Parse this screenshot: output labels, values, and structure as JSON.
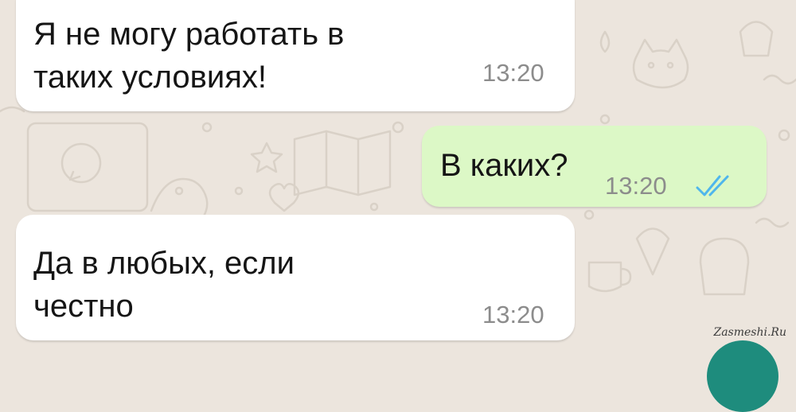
{
  "chat": {
    "messages": [
      {
        "direction": "incoming",
        "text": "Я не могу работать в\nтаких условиях!",
        "time": "13:20"
      },
      {
        "direction": "outgoing",
        "text": "В каких?",
        "time": "13:20",
        "status": "read"
      },
      {
        "direction": "incoming",
        "text": "Да в любых, если\nчестно",
        "time": "13:20"
      }
    ]
  },
  "watermark": "Zasmeshi.Ru",
  "colors": {
    "background": "#ece5dd",
    "incoming_bubble": "#ffffff",
    "outgoing_bubble": "#dcf8c6",
    "read_ticks": "#4fb6ec",
    "time_text": "#8c8c8c",
    "fab": "#1e8c7d"
  },
  "icons": {
    "read_status": "double-check-icon",
    "fab": "compose-fab-icon"
  }
}
